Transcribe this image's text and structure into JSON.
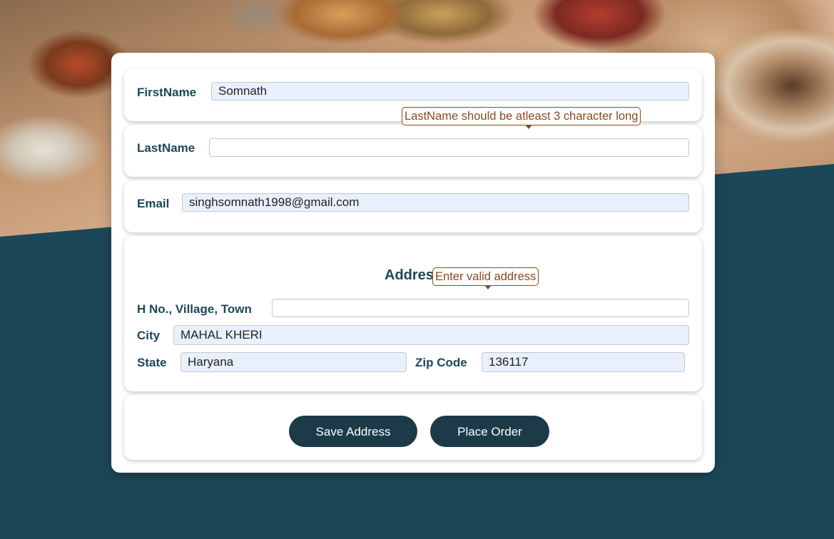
{
  "background": {
    "description_label": "",
    "page_color": "#1c4759"
  },
  "form": {
    "first_name": {
      "label": "FirstName",
      "value": "Somnath"
    },
    "last_name": {
      "label": "LastName",
      "value": "",
      "error": "LastName should be atleast 3 character long"
    },
    "email": {
      "label": "Email",
      "value": "singhsomnath1998@gmail.com"
    },
    "address": {
      "heading": "Address",
      "error": "Enter valid address",
      "house": {
        "label": "H No., Village, Town",
        "value": ""
      },
      "city": {
        "label": "City",
        "value": "MAHAL KHERI"
      },
      "state": {
        "label": "State",
        "value": "Haryana"
      },
      "zip": {
        "label": "Zip Code",
        "value": "136117"
      }
    },
    "actions": {
      "save_label": "Save Address",
      "order_label": "Place Order"
    }
  },
  "colors": {
    "accent": "#1c4759",
    "button": "#1c3a48",
    "error": "#8b4a1f",
    "autofill": "#e8f0fe"
  }
}
